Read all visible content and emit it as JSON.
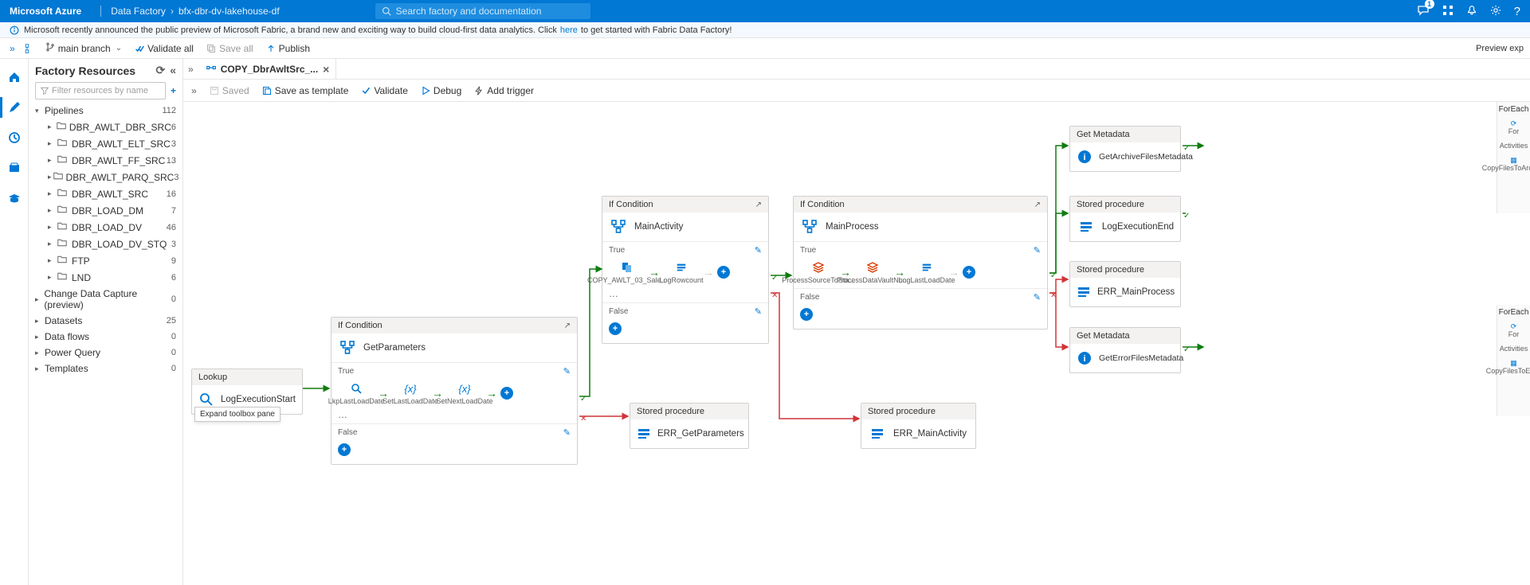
{
  "brand": "Microsoft Azure",
  "breadcrumbs": [
    "Data Factory",
    "bfx-dbr-dv-lakehouse-df"
  ],
  "search_placeholder": "Search factory and documentation",
  "infobar": {
    "prefix": "Microsoft recently announced the public preview of Microsoft Fabric, a brand new and exciting way to build cloud-first data analytics. Click",
    "link": "here",
    "suffix": "to get started with Fabric Data Factory!"
  },
  "toolbar": {
    "branch": "main branch",
    "validate_all": "Validate all",
    "save_all": "Save all",
    "publish": "Publish",
    "preview": "Preview exp"
  },
  "respanel": {
    "title": "Factory Resources",
    "filter_placeholder": "Filter resources by name",
    "groups": [
      {
        "name": "Pipelines",
        "count": "112",
        "expanded": true,
        "children": [
          {
            "name": "DBR_AWLT_DBR_SRC",
            "count": "6"
          },
          {
            "name": "DBR_AWLT_ELT_SRC",
            "count": "3"
          },
          {
            "name": "DBR_AWLT_FF_SRC",
            "count": "13"
          },
          {
            "name": "DBR_AWLT_PARQ_SRC",
            "count": "3"
          },
          {
            "name": "DBR_AWLT_SRC",
            "count": "16"
          },
          {
            "name": "DBR_LOAD_DM",
            "count": "7"
          },
          {
            "name": "DBR_LOAD_DV",
            "count": "46"
          },
          {
            "name": "DBR_LOAD_DV_STQ",
            "count": "3"
          },
          {
            "name": "FTP",
            "count": "9"
          },
          {
            "name": "LND",
            "count": "6"
          }
        ]
      },
      {
        "name": "Change Data Capture (preview)",
        "count": "0"
      },
      {
        "name": "Datasets",
        "count": "25"
      },
      {
        "name": "Data flows",
        "count": "0"
      },
      {
        "name": "Power Query",
        "count": "0"
      },
      {
        "name": "Templates",
        "count": "0"
      }
    ]
  },
  "tab": {
    "label": "COPY_DbrAwltSrc_..."
  },
  "subtoolbar": {
    "saved": "Saved",
    "save_template": "Save as template",
    "validate": "Validate",
    "debug": "Debug",
    "add_trigger": "Add trigger"
  },
  "tooltip_expand": "Expand toolbox pane",
  "canvas": {
    "lookup": {
      "title": "Lookup",
      "name": "LogExecutionStart"
    },
    "ifcond1": {
      "title": "If Condition",
      "name": "GetParameters",
      "true": "True",
      "false": "False",
      "minis": [
        {
          "icon": "lookup",
          "label": "LkpLastLoadDate"
        },
        {
          "icon": "var",
          "label": "SetLastLoadDate"
        },
        {
          "icon": "var",
          "label": "SetNextLoadDate"
        }
      ],
      "ellipsis": "…"
    },
    "sp_err_getparam": {
      "title": "Stored procedure",
      "name": "ERR_GetParameters"
    },
    "ifcond2": {
      "title": "If Condition",
      "name": "MainActivity",
      "true": "True",
      "false": "False",
      "minis": [
        {
          "icon": "copy",
          "label": "COPY_AWLT_03_Sale..."
        },
        {
          "icon": "sp",
          "label": "LogRowcount"
        }
      ],
      "ellipsis": "…"
    },
    "sp_err_mainact": {
      "title": "Stored procedure",
      "name": "ERR_MainActivity"
    },
    "ifcond3": {
      "title": "If Condition",
      "name": "MainProcess",
      "true": "True",
      "false": "False",
      "minis": [
        {
          "icon": "db",
          "label": "ProcessSourceToSta..."
        },
        {
          "icon": "db",
          "label": "ProcessDataVaultNo..."
        },
        {
          "icon": "sp",
          "label": "LogLastLoadDate"
        }
      ]
    },
    "meta1": {
      "title": "Get Metadata",
      "name": "GetArchiveFilesMetadata"
    },
    "sp_logexecend": {
      "title": "Stored procedure",
      "name": "LogExecutionEnd"
    },
    "sp_err_mainproc": {
      "title": "Stored procedure",
      "name": "ERR_MainProcess"
    },
    "meta2": {
      "title": "Get Metadata",
      "name": "GetErrorFilesMetadata"
    },
    "foreach_top": {
      "title": "ForEach",
      "for": "For",
      "acts": "Activities",
      "item": "CopyFilesToArchive"
    },
    "foreach_bottom": {
      "title": "ForEach",
      "for": "For",
      "acts": "Activities",
      "item": "CopyFilesToError"
    }
  }
}
